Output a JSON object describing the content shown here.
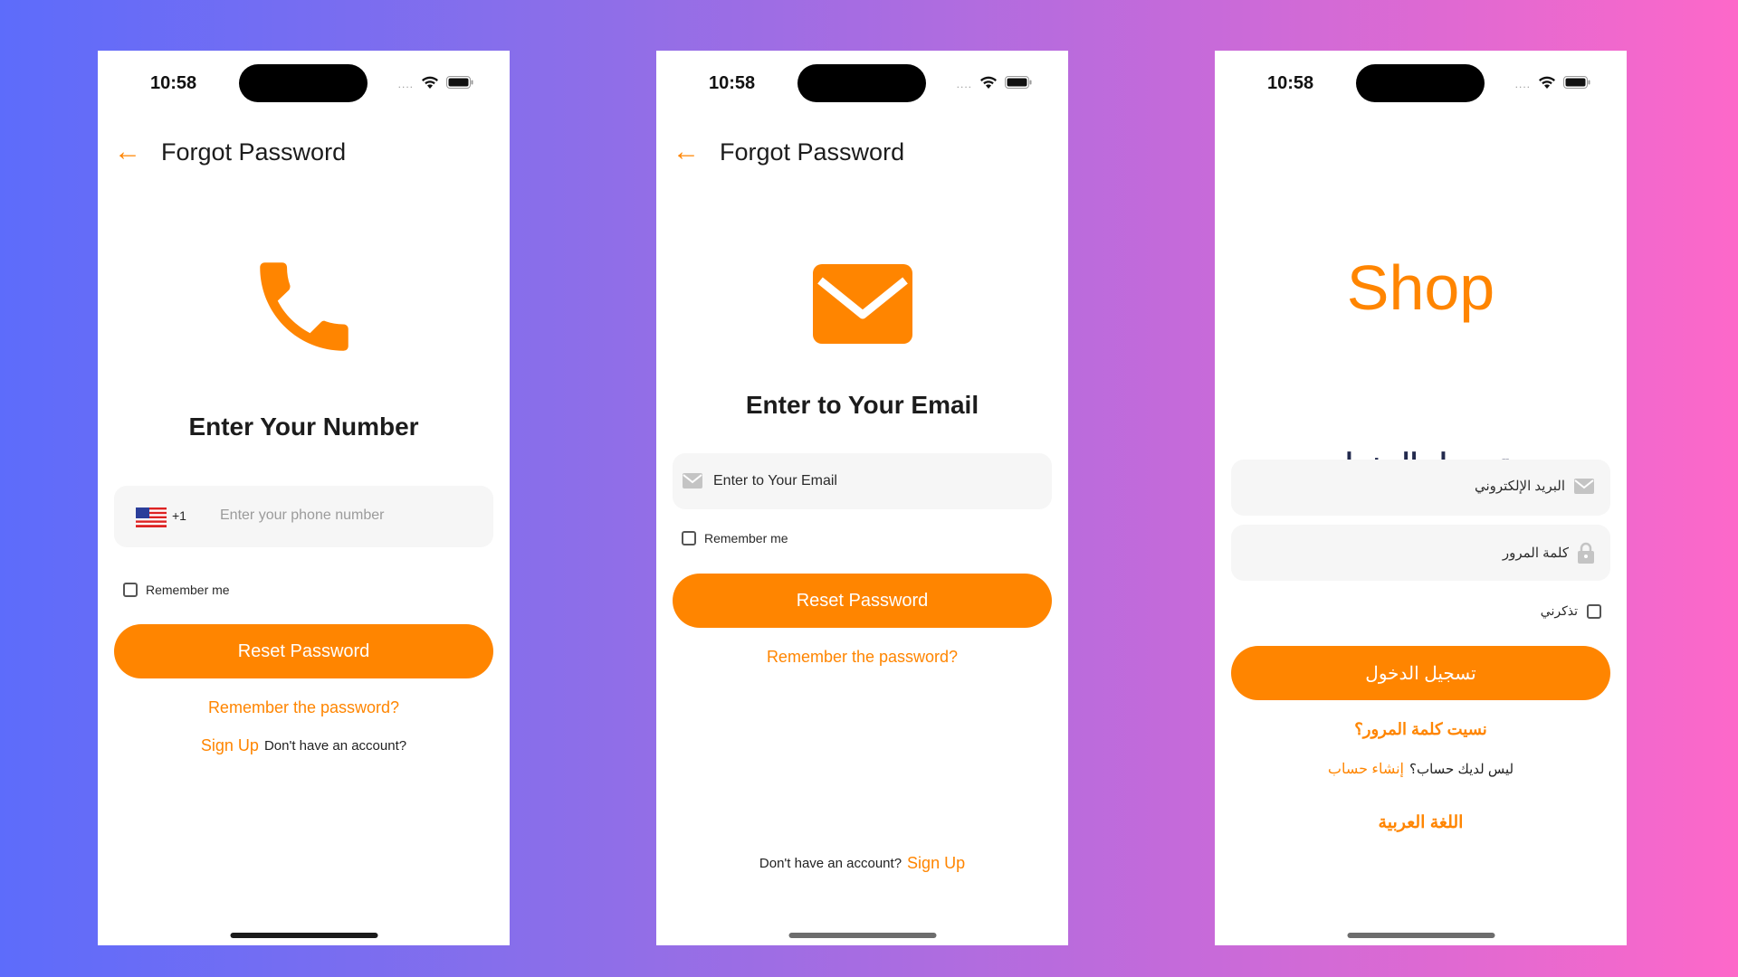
{
  "colors": {
    "accent": "#ff8500",
    "background_start": "#5d6cfb",
    "background_end": "#fd68c9",
    "field": "#f6f6f6",
    "text": "#1c1c1c"
  },
  "status_bar": {
    "time": "10:58",
    "signal_dots": "....",
    "icons": [
      "wifi-icon",
      "battery-icon"
    ]
  },
  "screen_phone": {
    "title": "Forgot Password",
    "hero_icon": "phone-icon",
    "heading": "Enter Your Number",
    "country_flag": "us-flag-icon",
    "country_code": "+1",
    "phone_placeholder": "Enter your phone number",
    "remember_me": "Remember me",
    "reset_button": "Reset Password",
    "remember_link": "Remember the password?",
    "signup_link": "Sign Up",
    "no_account": "Don't have an account?"
  },
  "screen_email": {
    "title": "Forgot Password",
    "hero_icon": "mail-icon",
    "heading": "Enter to Your Email",
    "email_placeholder": "Enter to Your Email",
    "remember_me": "Remember me",
    "reset_button": "Reset Password",
    "remember_link": "Remember the password?",
    "no_account": "Don't have an account?",
    "signup_link": "Sign Up"
  },
  "screen_login_ar": {
    "logo": "Shop",
    "heading": "تسجيل الدخول",
    "email_placeholder": "البريد الإلكتروني",
    "password_placeholder": "كلمة المرور",
    "remember_me": "تذكرني",
    "login_button": "تسجيل الدخول",
    "forgot_link": "نسيت كلمة المرور؟",
    "no_account": "ليس لديك حساب؟",
    "signup_link": "إنشاء حساب",
    "language_link": "اللغة العربية"
  }
}
